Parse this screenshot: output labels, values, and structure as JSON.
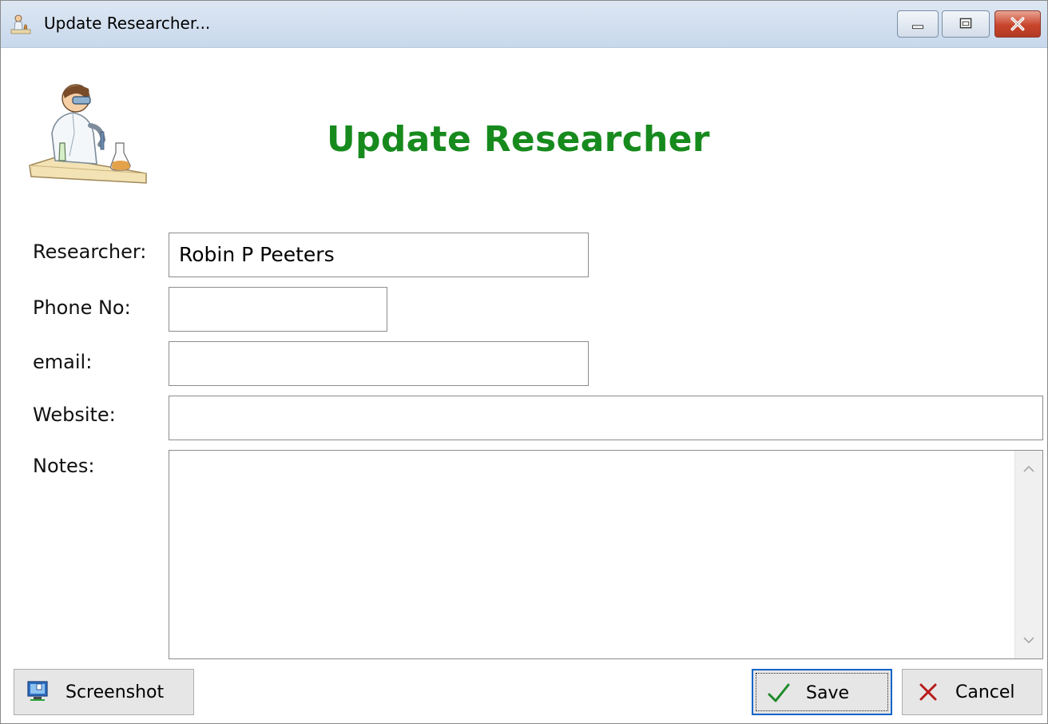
{
  "window": {
    "title": "Update Researcher...",
    "title_icon": "scientist-icon",
    "controls": {
      "minimize": "minimize-icon",
      "maximize": "maximize-icon",
      "close": "close-icon"
    },
    "close_color": "#c8442b"
  },
  "header": {
    "heading": "Update Researcher",
    "heading_color": "#178a1d",
    "image": "scientist-illustration"
  },
  "form": {
    "researcher_label": "Researcher:",
    "researcher_value": "Robin P Peeters",
    "phone_label": "Phone No:",
    "phone_value": "",
    "email_label": "email:",
    "email_value": "",
    "website_label": "Website:",
    "website_value": "",
    "notes_label": "Notes:",
    "notes_value": ""
  },
  "buttons": {
    "screenshot_label": "Screenshot",
    "screenshot_icon": "monitor-icon",
    "save_label": "Save",
    "save_icon": "checkmark-icon",
    "cancel_label": "Cancel",
    "cancel_icon": "x-icon",
    "focus_color": "#0a64c8"
  }
}
